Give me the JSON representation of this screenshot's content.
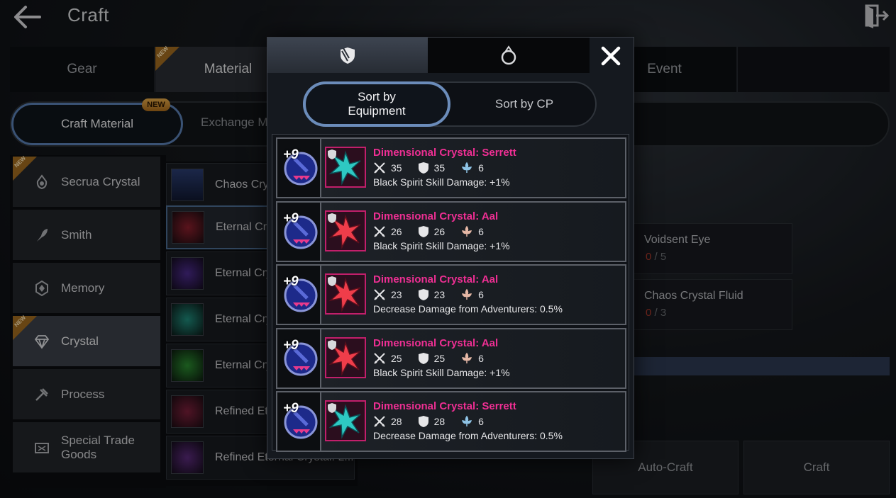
{
  "header": {
    "title": "Craft"
  },
  "main_tabs": [
    {
      "label": "Gear",
      "new": false
    },
    {
      "label": "Material",
      "new": true,
      "badge": "NEW"
    },
    {
      "label": "Event",
      "new": false
    }
  ],
  "sub_tabs": [
    {
      "label": "Craft Material",
      "badge": "NEW"
    },
    {
      "label": "Exchange Material"
    }
  ],
  "categories": [
    {
      "label": "Secrua Crystal",
      "icon": "crystal-drop-icon",
      "new": true,
      "badge": "NEW"
    },
    {
      "label": "Smith",
      "icon": "feather-icon",
      "new": false
    },
    {
      "label": "Memory",
      "icon": "memory-crest-icon",
      "new": false
    },
    {
      "label": "Crystal",
      "icon": "diamond-icon",
      "new": true,
      "badge": "NEW",
      "active": true
    },
    {
      "label": "Process",
      "icon": "hammer-icon",
      "new": false
    },
    {
      "label": "Special Trade Goods",
      "icon": "trade-box-icon",
      "new": false
    }
  ],
  "recipes": [
    {
      "label": "Chaos Crys"
    },
    {
      "label": "Eternal Cry",
      "active": true
    },
    {
      "label": "Eternal Cry"
    },
    {
      "label": "Eternal Cry"
    },
    {
      "label": "Eternal Cry"
    },
    {
      "label": "Refined Eter"
    },
    {
      "label": "Refined Eternal Crystal: L..."
    }
  ],
  "requirements": [
    {
      "name": "Voidsent Eye",
      "have": "0",
      "sep": "/",
      "need": "5"
    },
    {
      "name": "Chaos Crystal Fluid",
      "have": "0",
      "sep": "/",
      "need": "3"
    }
  ],
  "bg_buttons": {
    "auto_craft": "Auto-Craft",
    "craft": "Craft"
  },
  "modal": {
    "tabs": [
      {
        "icon": "gear-shield-icon"
      },
      {
        "icon": "ring-icon"
      }
    ],
    "close_icon": "close-icon",
    "sort_equipment": "Sort by\nEquipment",
    "sort_cp": "Sort by CP",
    "items": [
      {
        "level": "+9",
        "name": "Dimensional Crystal: Serrett",
        "color": "teal",
        "attack": "35",
        "defense": "35",
        "third": "6",
        "effect": "Black Spirit Skill Damage: +1%"
      },
      {
        "level": "+9",
        "name": "Dimensional Crystal: Aal",
        "color": "red",
        "attack": "26",
        "defense": "26",
        "third": "6",
        "effect": "Black Spirit Skill Damage: +1%"
      },
      {
        "level": "+9",
        "name": "Dimensional Crystal: Aal",
        "color": "red",
        "attack": "23",
        "defense": "23",
        "third": "6",
        "effect": "Decrease Damage from Adventurers: 0.5%"
      },
      {
        "level": "+9",
        "name": "Dimensional Crystal: Aal",
        "color": "red",
        "attack": "25",
        "defense": "25",
        "third": "6",
        "effect": "Black Spirit Skill Damage: +1%"
      },
      {
        "level": "+9",
        "name": "Dimensional Crystal: Serrett",
        "color": "teal",
        "attack": "28",
        "defense": "28",
        "third": "6",
        "effect": "Decrease Damage from Adventurers: 0.5%"
      }
    ]
  },
  "colors": {
    "accent_blue": "#5a7fb3",
    "item_name": "#ee2f93",
    "badge_orange": "#a06a20"
  }
}
